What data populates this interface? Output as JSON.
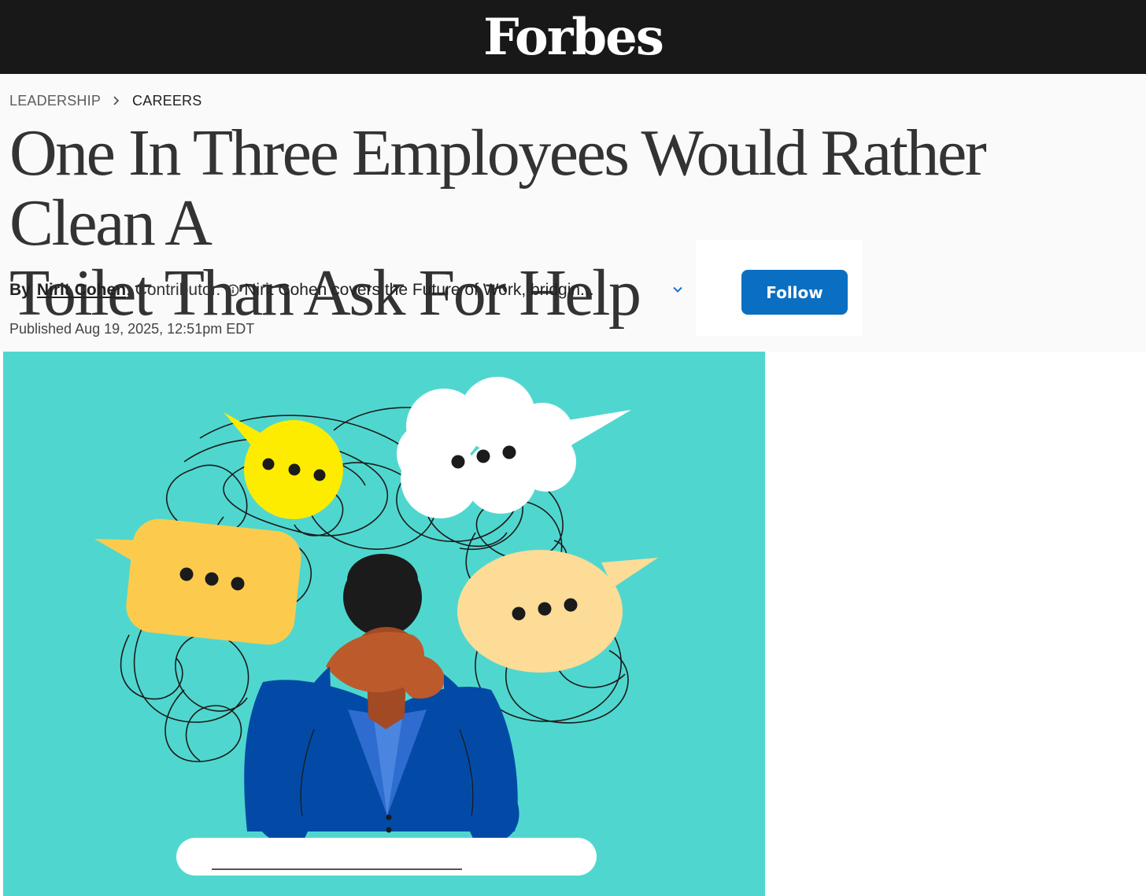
{
  "site": {
    "logo": "Forbes"
  },
  "breadcrumb": {
    "section": "LEADERSHIP",
    "subsection": "CAREERS"
  },
  "article": {
    "headline_line1": "One In Three Employees Would Rather Clean A",
    "headline_line2": "Toilet Than Ask For Help",
    "byline_prefix": "By",
    "author": "Nirit Cohen",
    "author_role": ", Contributor.",
    "author_description": "Nirit Cohen covers the Future of Work, bridgin...",
    "published": "Published Aug 19, 2025, 12:51pm EDT"
  },
  "actions": {
    "follow_label": "Follow"
  },
  "icons": {
    "info": "info-icon",
    "expand": "chevron-down-icon"
  },
  "colors": {
    "topbar": "#181818",
    "follow_button": "#0a6fc2",
    "hero_background": "#4fd7cf"
  }
}
